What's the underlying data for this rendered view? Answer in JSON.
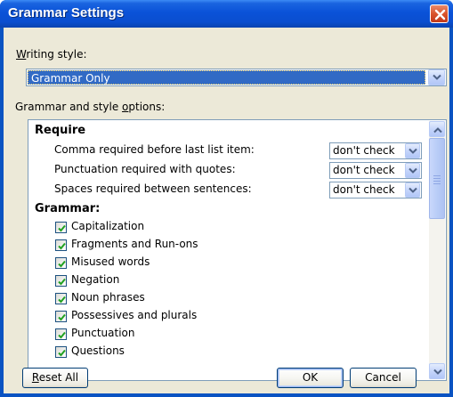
{
  "window": {
    "title": "Grammar Settings"
  },
  "writing_style": {
    "label_prefix": "W",
    "label_rest": "riting style:",
    "value": "Grammar Only"
  },
  "options": {
    "label_prefix": "Grammar and style ",
    "label_underlined": "o",
    "label_rest": "ptions:"
  },
  "require": {
    "heading": "Require",
    "items": [
      {
        "label": "Comma required before last list item:",
        "value": "don't check"
      },
      {
        "label": "Punctuation required with quotes:",
        "value": "don't check"
      },
      {
        "label": "Spaces required between sentences:",
        "value": "don't check"
      }
    ]
  },
  "grammar": {
    "heading": "Grammar:",
    "items": [
      {
        "label": "Capitalization",
        "checked": true
      },
      {
        "label": "Fragments and Run-ons",
        "checked": true
      },
      {
        "label": "Misused words",
        "checked": true
      },
      {
        "label": "Negation",
        "checked": true
      },
      {
        "label": "Noun phrases",
        "checked": true
      },
      {
        "label": "Possessives and plurals",
        "checked": true
      },
      {
        "label": "Punctuation",
        "checked": true
      },
      {
        "label": "Questions",
        "checked": true
      }
    ]
  },
  "buttons": {
    "reset_prefix": "R",
    "reset_rest": "eset All",
    "ok": "OK",
    "cancel": "Cancel"
  },
  "icons": {
    "close": "close-icon",
    "dropdown": "chevron-down-icon",
    "scroll_up": "chevron-up-icon",
    "check": "checkmark-icon"
  },
  "colors": {
    "titlebar": "#0a52d8",
    "selection": "#316ac5",
    "dialog_face": "#ece9d8",
    "close_button": "#d9542c"
  }
}
